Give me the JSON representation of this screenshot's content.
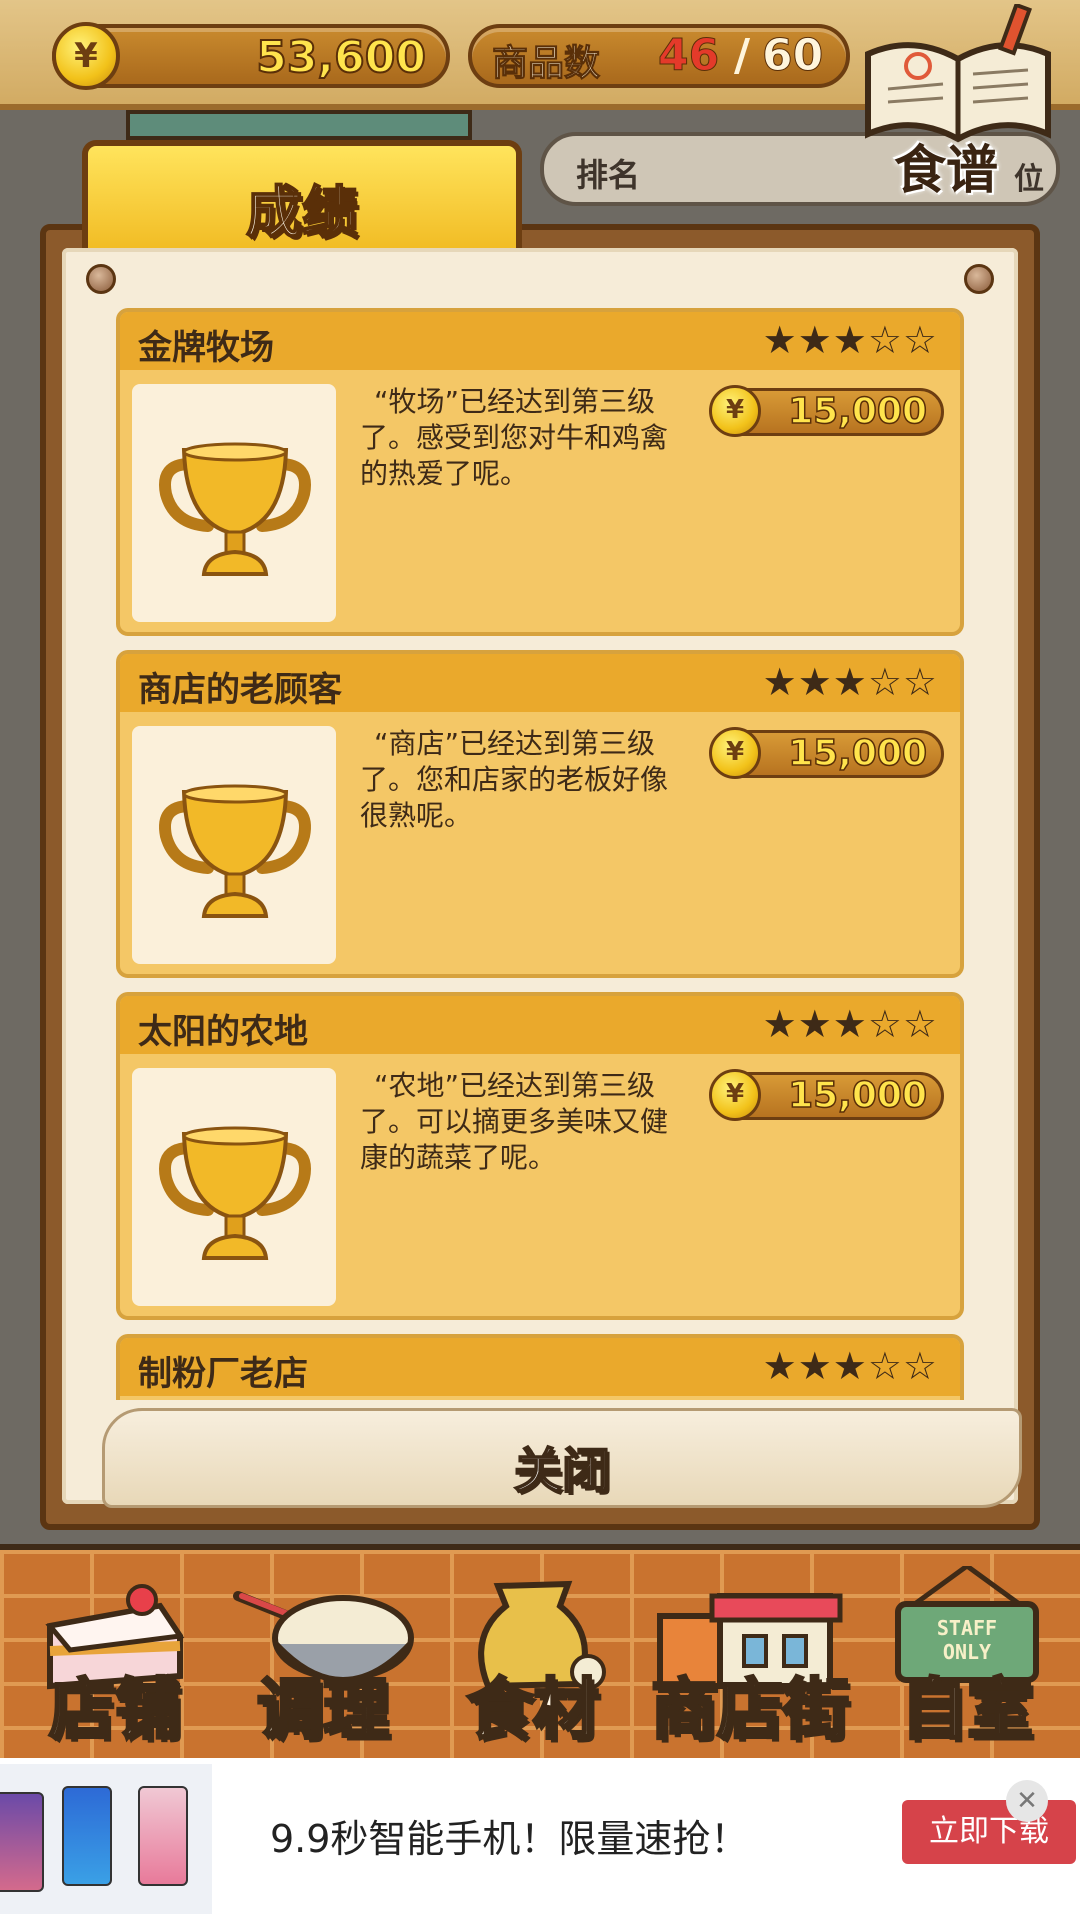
{
  "hud": {
    "money": "53,600",
    "currency_symbol": "¥",
    "item_count_label": "商品数",
    "item_count_current": "46",
    "item_count_sep": "/",
    "item_count_total": "60"
  },
  "recipe_button": {
    "label": "食谱"
  },
  "ranking_tab": {
    "label": "排名",
    "suffix": "位"
  },
  "achievements_tab": {
    "label": "成绩"
  },
  "achievements": [
    {
      "title": "金牌牧场",
      "stars": "★★★☆☆",
      "stars_filled": 3,
      "stars_total": 5,
      "description": "“牧场”已经达到第三级了。感受到您对牛和鸡禽的热爱了呢。",
      "reward": "15,000"
    },
    {
      "title": "商店的老顾客",
      "stars": "★★★☆☆",
      "stars_filled": 3,
      "stars_total": 5,
      "description": "“商店”已经达到第三级了。您和店家的老板好像很熟呢。",
      "reward": "15,000"
    },
    {
      "title": "太阳的农地",
      "stars": "★★★☆☆",
      "stars_filled": 3,
      "stars_total": 5,
      "description": "“农地”已经达到第三级了。可以摘更多美味又健康的蔬菜了呢。",
      "reward": "15,000"
    },
    {
      "title": "制粉厂老店",
      "stars": "★★★☆☆",
      "stars_filled": 3,
      "stars_total": 5
    }
  ],
  "close_button": {
    "label": "关闭"
  },
  "nav": {
    "items": [
      {
        "label": "店铺",
        "icon": "cake-icon"
      },
      {
        "label": "调理",
        "icon": "mixing-bowl-icon"
      },
      {
        "label": "食材",
        "icon": "flour-sack-icon"
      },
      {
        "label": "商店街",
        "icon": "shop-street-icon"
      },
      {
        "label": "自室",
        "icon": "staff-only-sign-icon"
      }
    ],
    "staff_sign": "STAFF ONLY"
  },
  "ad": {
    "text": "9.9秒智能手机！限量速抢！",
    "button_label": "立即下载",
    "close_glyph": "✕"
  },
  "colors": {
    "accent_gold": "#eaa92c",
    "card_bg": "#f4c766",
    "count_red": "#e43a2a",
    "ad_button": "#d6434a"
  }
}
